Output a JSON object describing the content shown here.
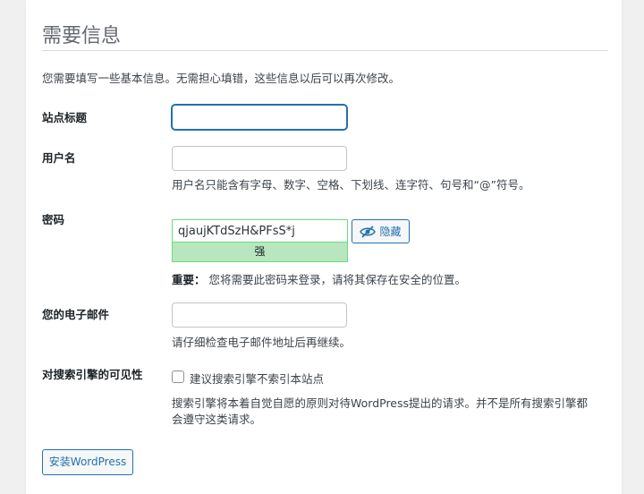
{
  "page": {
    "heading": "需要信息",
    "intro": "您需要填写一些基本信息。无需担心填错，这些信息以后可以再次修改。"
  },
  "form": {
    "site_title": {
      "label": "站点标题",
      "value": ""
    },
    "username": {
      "label": "用户名",
      "value": "",
      "hint": "用户名只能含有字母、数字、空格、下划线、连字符、句号和“@”符号。"
    },
    "password": {
      "label": "密码",
      "value": "qjaujKTdSzH&PFsS*j",
      "strength": "强",
      "hide_label": "隐藏",
      "important_label": "重要：",
      "important_text": "您将需要此密码来登录，请将其保存在安全的位置。"
    },
    "email": {
      "label": "您的电子邮件",
      "value": "",
      "hint": "请仔细检查电子邮件地址后再继续。"
    },
    "visibility": {
      "label": "对搜索引擎的可见性",
      "checkbox_label": "建议搜索引擎不索引本站点",
      "checked": false,
      "hint_line1": "搜索引擎将本着自觉自愿的原则对待WordPress提出的请求。并不是所有搜索引擎都",
      "hint_line2": "会遵守这类请求。"
    }
  },
  "actions": {
    "install_label": "安装WordPress"
  }
}
